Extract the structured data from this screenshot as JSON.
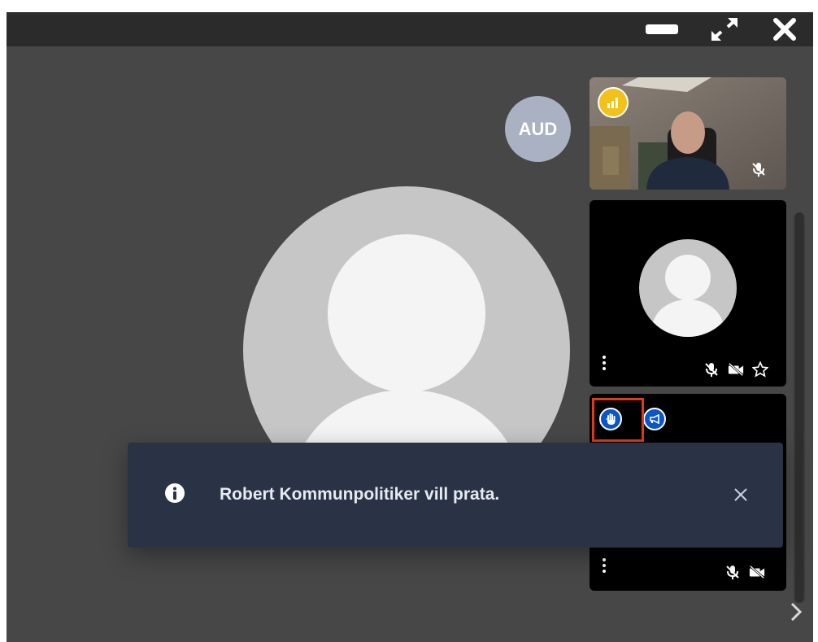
{
  "window": {
    "minimize_icon": "minimize-bar-icon",
    "fullscreen_icon": "exit-fullscreen-arrows-icon",
    "close_icon": "close-x-icon"
  },
  "stage": {
    "audience_badge": "AUD"
  },
  "participants": [
    {
      "type": "camera",
      "active_speaker_icon": "audio-level-icon",
      "mic_muted": true
    },
    {
      "type": "avatar",
      "mic_muted": true,
      "camera_off": true,
      "favorite_icon": "star-outline-icon"
    },
    {
      "type": "avatar",
      "raised_hand": true,
      "raise_hand_icon": "hand-icon",
      "speaker_request_icon": "megaphone-icon",
      "mic_muted": true,
      "camera_off": true
    }
  ],
  "toast": {
    "icon": "info-circle-icon",
    "message": "Robert Kommunpolitiker vill prata.",
    "close_icon": "close-x-icon"
  },
  "colors": {
    "toast_bg": "#293345",
    "hand_button": "#0c57c7",
    "highlight": "#e03a1c",
    "speaker_badge": "#f2c21b"
  }
}
